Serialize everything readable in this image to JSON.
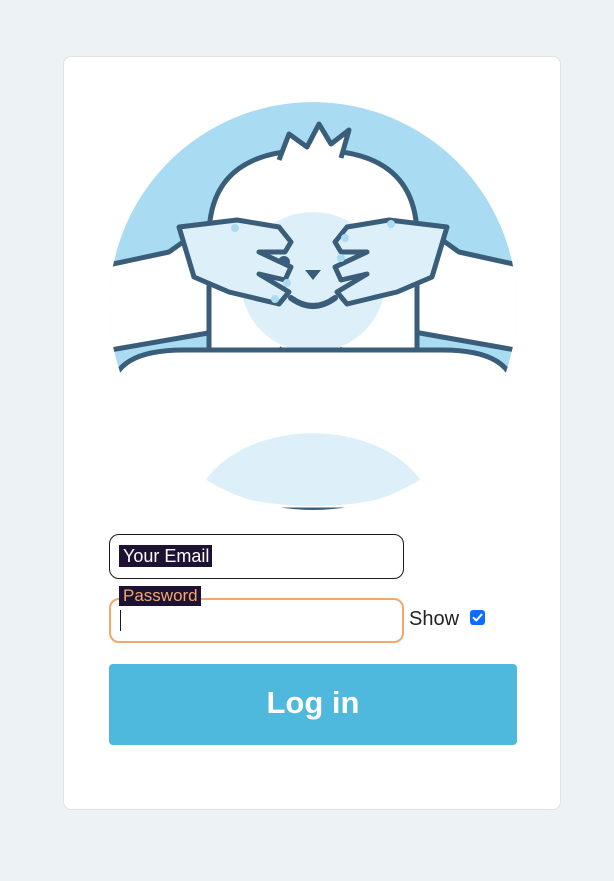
{
  "login_form": {
    "email_label": "Your Email",
    "password_label": "Password",
    "password_value": "",
    "show_label": "Show",
    "show_checked": true,
    "login_button": "Log in"
  },
  "colors": {
    "background": "#edf2f4",
    "card": "#ffffff",
    "yeti_circle": "#a9dcf3",
    "yeti_outline": "#3a5e7a",
    "yeti_light": "#ddf0fa",
    "focus_border": "#f2a86b",
    "label_background": "#1d1233",
    "button": "#4eb8dd",
    "checkbox": "#0d6efd"
  },
  "illustration": {
    "icon": "yeti-covering-eyes-icon"
  }
}
